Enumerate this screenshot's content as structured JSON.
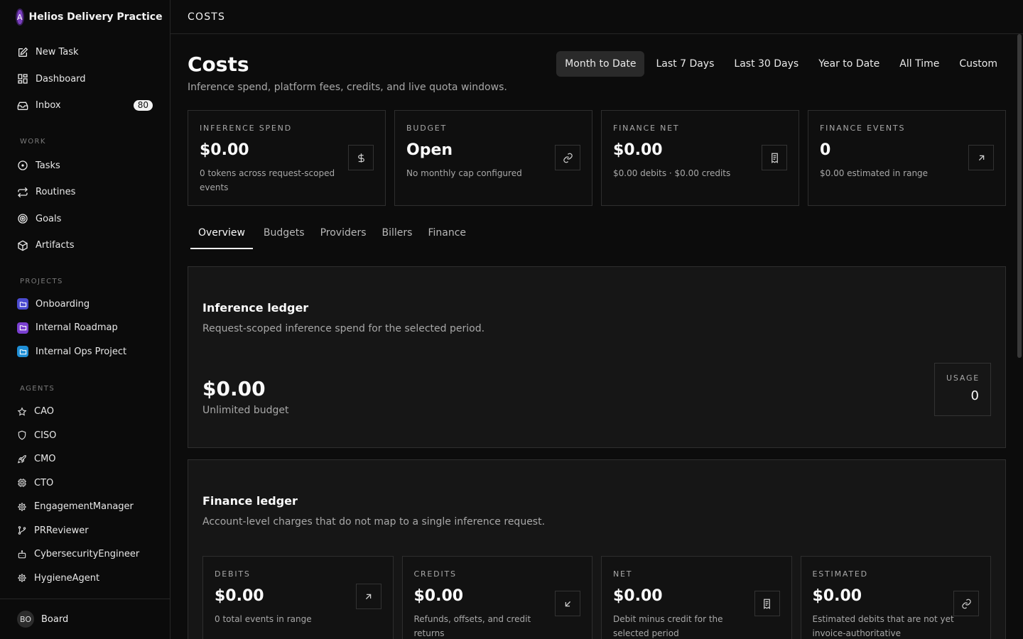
{
  "company": {
    "logo_letter": "A",
    "name": "Helios Delivery Practice"
  },
  "nav": [
    {
      "label": "New Task",
      "icon": "edit-icon"
    },
    {
      "label": "Dashboard",
      "icon": "dashboard-icon"
    },
    {
      "label": "Inbox",
      "icon": "inbox-icon",
      "badge": "80"
    }
  ],
  "sections": {
    "work": "WORK",
    "projects": "PROJECTS",
    "agents": "AGENTS"
  },
  "work": [
    {
      "label": "Tasks",
      "icon": "circle-dot-icon"
    },
    {
      "label": "Routines",
      "icon": "repeat-icon"
    },
    {
      "label": "Goals",
      "icon": "target-icon"
    },
    {
      "label": "Artifacts",
      "icon": "box-icon"
    }
  ],
  "projects": [
    {
      "label": "Onboarding",
      "color": "#6e6ef0"
    },
    {
      "label": "Internal Roadmap",
      "color": "#8a4fd8"
    },
    {
      "label": "Internal Ops Project",
      "color": "#2aa0e6"
    }
  ],
  "agents": [
    {
      "label": "CAO",
      "icon": "star-icon"
    },
    {
      "label": "CISO",
      "icon": "shield-icon"
    },
    {
      "label": "CMO",
      "icon": "rocket-icon"
    },
    {
      "label": "CTO",
      "icon": "cpu-icon"
    },
    {
      "label": "EngagementManager",
      "icon": "cog-icon"
    },
    {
      "label": "PRReviewer",
      "icon": "git-branch-icon"
    },
    {
      "label": "CybersecurityEngineer",
      "icon": "bot-icon"
    },
    {
      "label": "HygieneAgent",
      "icon": "cog-icon"
    }
  ],
  "board": {
    "initials": "BO",
    "label": "Board"
  },
  "topbar": {
    "title": "COSTS"
  },
  "page": {
    "title": "Costs",
    "subtitle": "Inference spend, platform fees, credits, and live quota windows."
  },
  "ranges": [
    "Month to Date",
    "Last 7 Days",
    "Last 30 Days",
    "Year to Date",
    "All Time",
    "Custom"
  ],
  "active_range": "Month to Date",
  "stats": [
    {
      "label": "INFERENCE SPEND",
      "value": "$0.00",
      "desc": "0 tokens across request-scoped events",
      "icon": "dollar-icon"
    },
    {
      "label": "BUDGET",
      "value": "Open",
      "desc": "No monthly cap configured",
      "icon": "link-icon"
    },
    {
      "label": "FINANCE NET",
      "value": "$0.00",
      "desc": "$0.00 debits · $0.00 credits",
      "icon": "receipt-icon"
    },
    {
      "label": "FINANCE EVENTS",
      "value": "0",
      "desc": "$0.00 estimated in range",
      "icon": "arrow-up-right-icon"
    }
  ],
  "tabs": [
    "Overview",
    "Budgets",
    "Providers",
    "Billers",
    "Finance"
  ],
  "active_tab": "Overview",
  "inference": {
    "title": "Inference ledger",
    "subtitle": "Request-scoped inference spend for the selected period.",
    "value": "$0.00",
    "desc": "Unlimited budget",
    "usage_label": "USAGE",
    "usage_value": "0"
  },
  "finance": {
    "title": "Finance ledger",
    "subtitle": "Account-level charges that do not map to a single inference request.",
    "cards": [
      {
        "label": "DEBITS",
        "value": "$0.00",
        "desc": "0 total events in range",
        "icon": "arrow-up-right-icon"
      },
      {
        "label": "CREDITS",
        "value": "$0.00",
        "desc": "Refunds, offsets, and credit returns",
        "icon": "arrow-down-left-icon"
      },
      {
        "label": "NET",
        "value": "$0.00",
        "desc": "Debit minus credit for the selected period",
        "icon": "receipt-icon"
      },
      {
        "label": "ESTIMATED",
        "value": "$0.00",
        "desc": "Estimated debits that are not yet invoice-authoritative",
        "icon": "link-icon"
      }
    ]
  }
}
